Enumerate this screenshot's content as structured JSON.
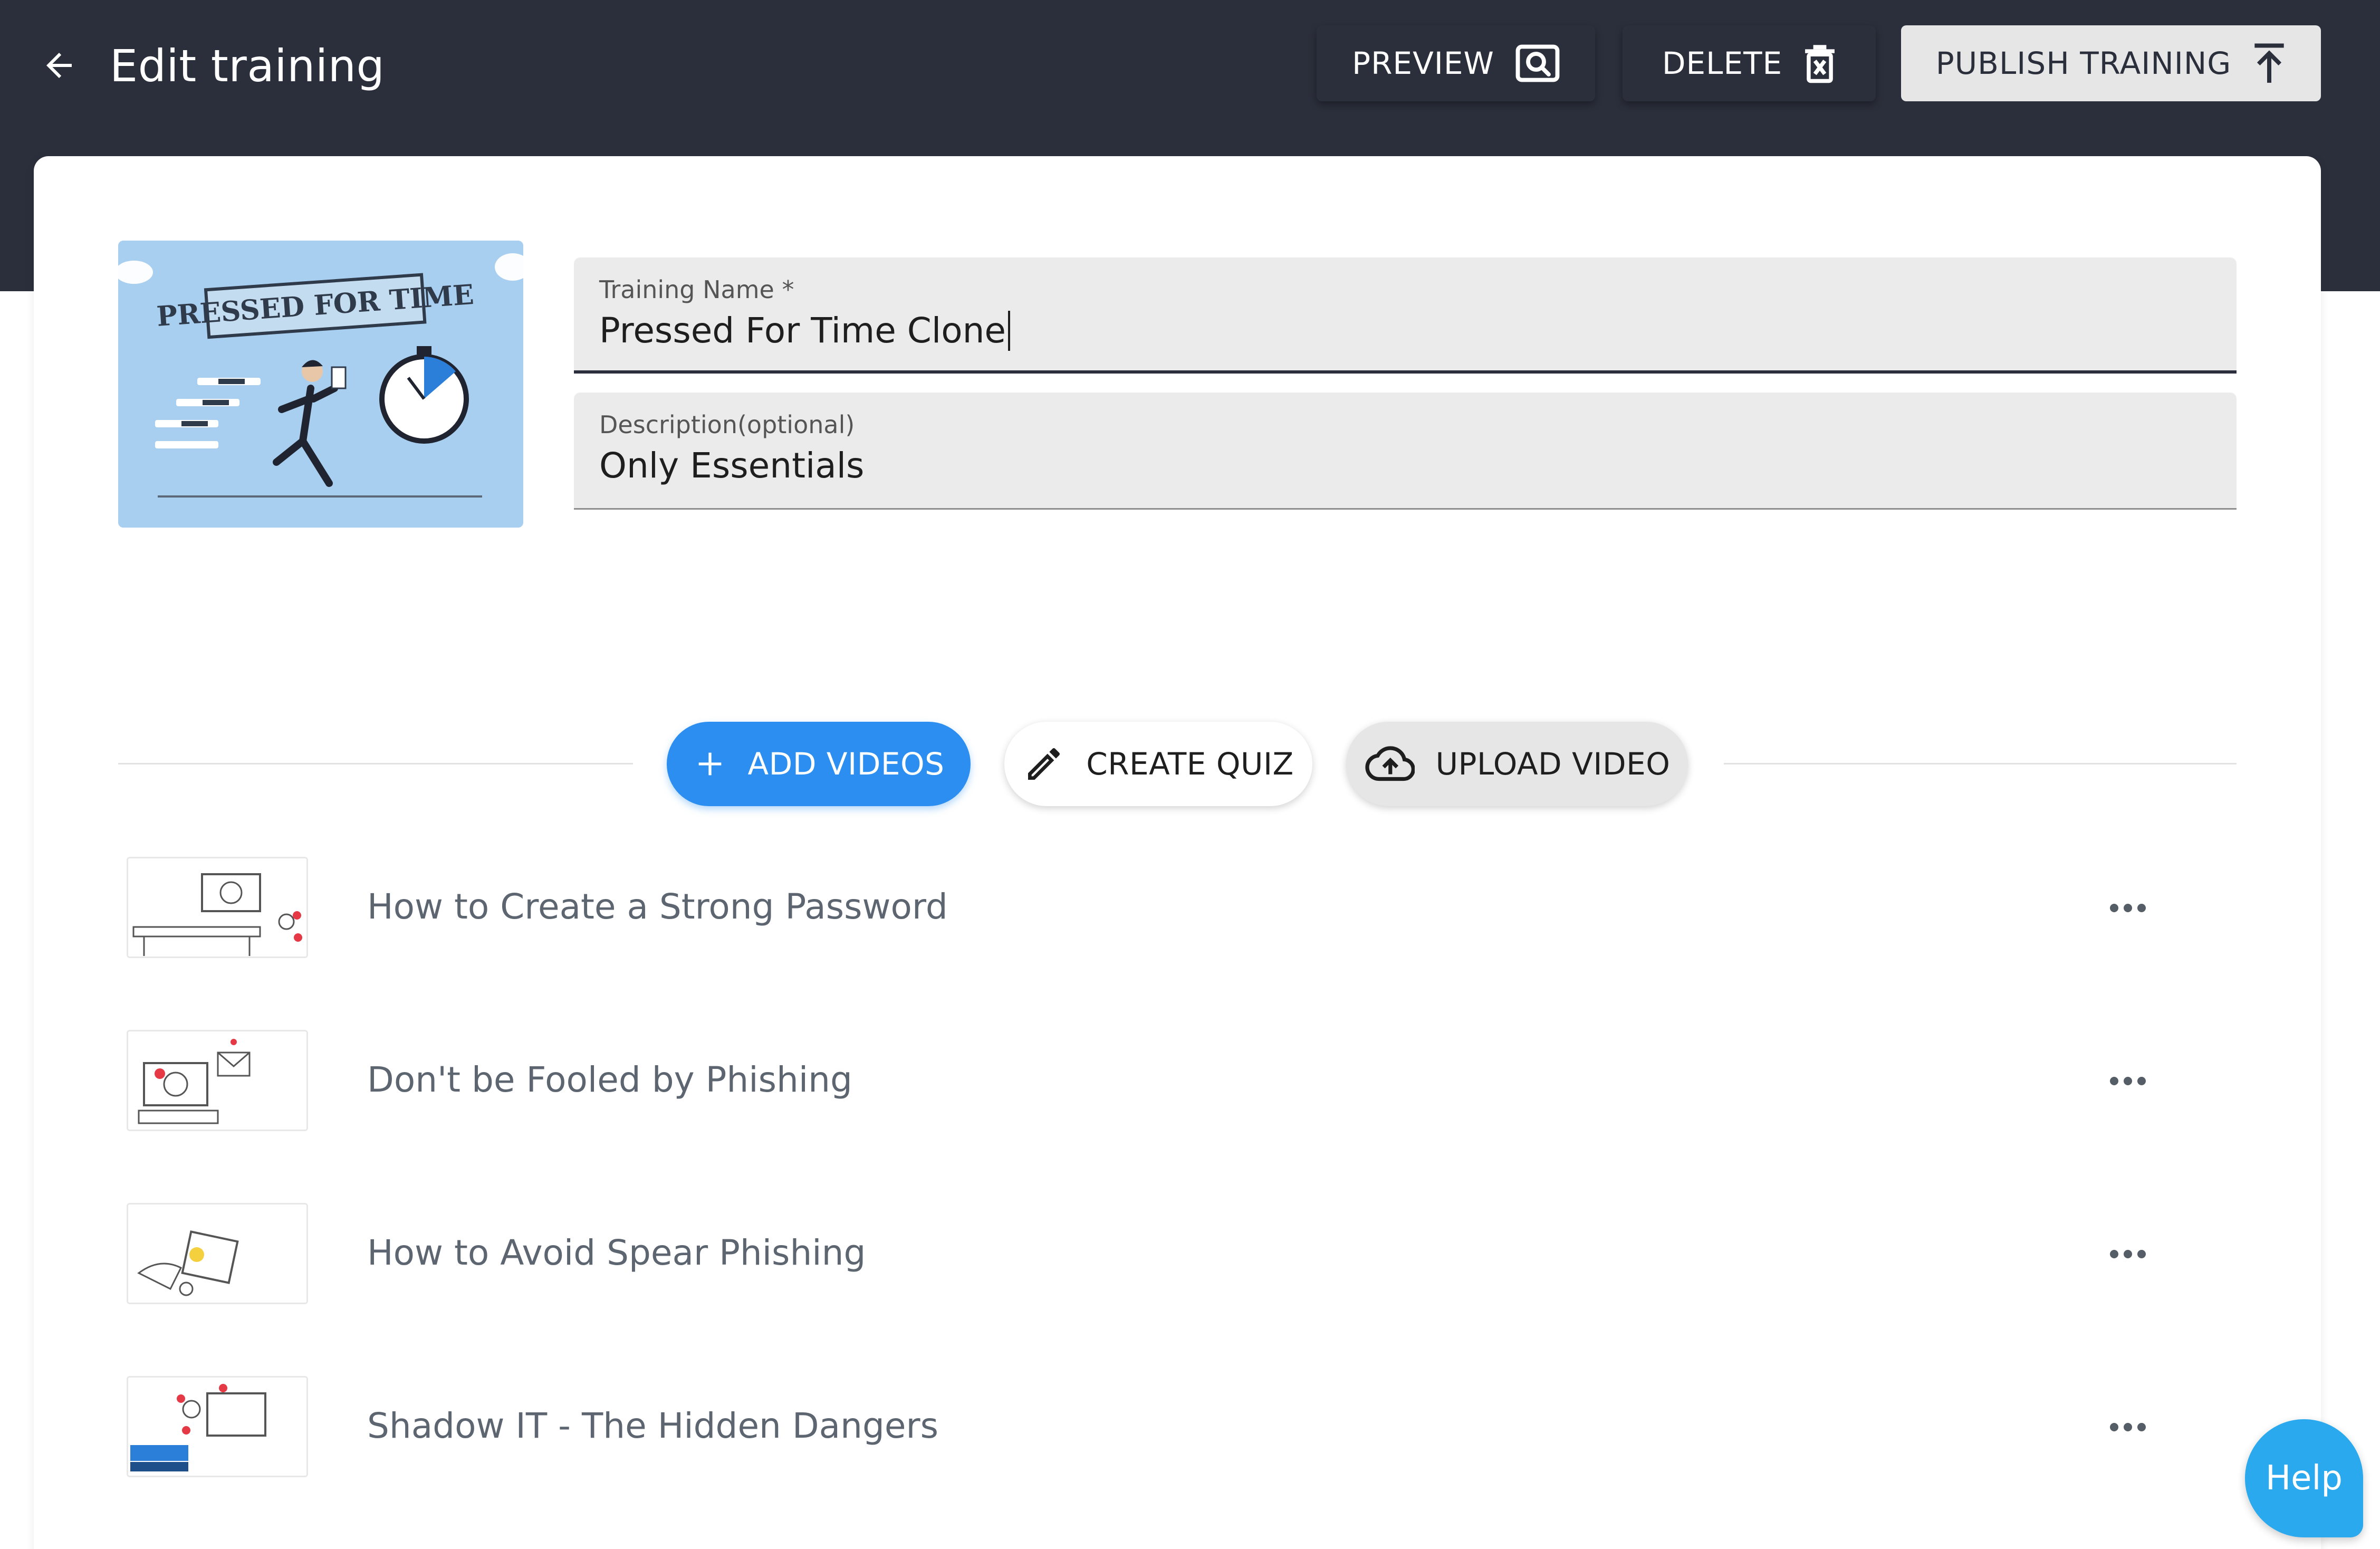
{
  "header": {
    "title": "Edit training",
    "back_icon": "arrow-left-icon",
    "preview_label": "PREVIEW",
    "delete_label": "DELETE",
    "publish_label": "PUBLISH TRAINING"
  },
  "cover": {
    "banner_text": "PRESSED FOR TIME"
  },
  "form": {
    "name_label": "Training Name *",
    "name_value": "Pressed For Time Clone",
    "description_label": "Description(optional)",
    "description_value": "Only Essentials"
  },
  "actions": {
    "add_videos": "ADD VIDEOS",
    "create_quiz": "CREATE QUIZ",
    "upload_video": "UPLOAD VIDEO"
  },
  "videos": [
    {
      "title": "How to Create a Strong Password"
    },
    {
      "title": "Don't be Fooled by Phishing"
    },
    {
      "title": "How to Avoid Spear Phishing"
    },
    {
      "title": "Shadow IT - The Hidden Dangers"
    }
  ],
  "help_label": "Help",
  "colors": {
    "header_bg": "#2b2f3b",
    "accent_blue": "#2b8ef0",
    "help_blue": "#2aa9ee"
  }
}
